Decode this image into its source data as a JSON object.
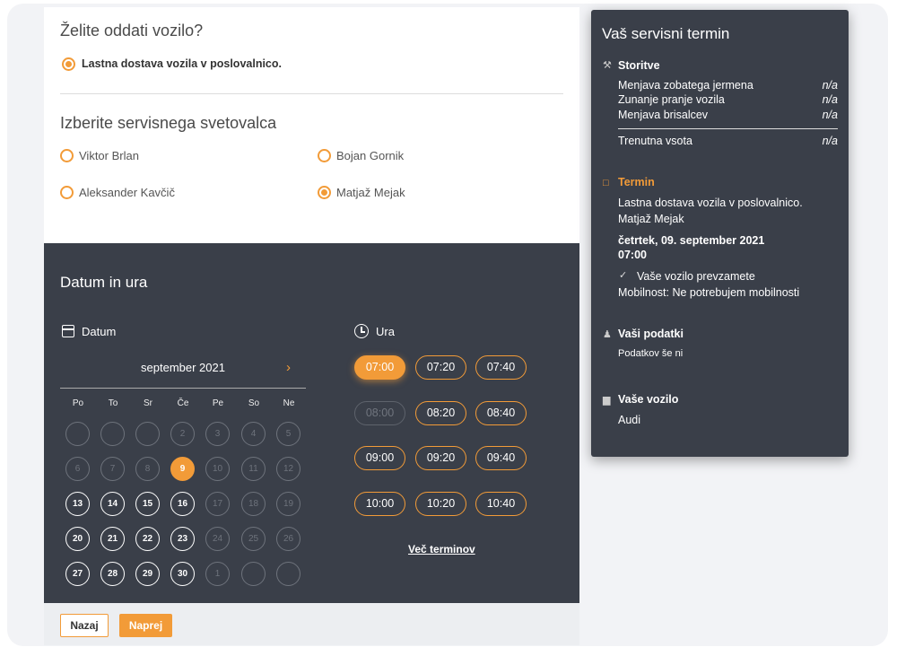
{
  "delivery": {
    "title": "Želite oddati vozilo?",
    "option_label": "Lastna dostava vozila v poslovalnico."
  },
  "advisor": {
    "title": "Izberite servisnega svetovalca",
    "options": [
      "Viktor Brlan",
      "Bojan Gornik",
      "Aleksander Kavčič",
      "Matjaž Mejak"
    ],
    "selected": "Matjaž Mejak"
  },
  "datetime": {
    "title": "Datum in ura",
    "date_label": "Datum",
    "time_label": "Ura",
    "month": "september 2021",
    "weekdays": [
      "Po",
      "To",
      "Sr",
      "Če",
      "Pe",
      "So",
      "Ne"
    ],
    "selected_day": "9",
    "times": [
      "07:00",
      "07:20",
      "07:40",
      "08:00",
      "08:20",
      "08:40",
      "09:00",
      "09:20",
      "09:40",
      "10:00",
      "10:20",
      "10:40"
    ],
    "selected_time": "07:00",
    "unavailable_times": [
      "08:00"
    ],
    "more_label": "Več terminov"
  },
  "footer": {
    "back_label": "Nazaj",
    "next_label": "Naprej"
  },
  "summary": {
    "title": "Vaš servisni termin",
    "services_heading": "Storitve",
    "services": [
      {
        "name": "Menjava zobatega jermena",
        "price": "n/a"
      },
      {
        "name": "Zunanje pranje vozila",
        "price": "n/a"
      },
      {
        "name": "Menjava brisalcev",
        "price": "n/a"
      }
    ],
    "total_label": "Trenutna vsota",
    "total_value": "n/a",
    "appointment_heading": "Termin",
    "appointment_delivery": "Lastna dostava vozila v poslovalnico.",
    "appointment_advisor": "Matjaž Mejak",
    "appointment_date": "četrtek, 09. september 2021",
    "appointment_time": "07:00",
    "pickup_note": "Vaše vozilo prevzamete",
    "mobility": "Mobilnost: Ne potrebujem mobilnosti",
    "personal_heading": "Vaši podatki",
    "personal_text": "Podatkov še ni",
    "vehicle_heading": "Vaše vozilo",
    "vehicle": "Audi"
  },
  "colors": {
    "accent": "#f29b38",
    "panel": "#3a3f49"
  }
}
